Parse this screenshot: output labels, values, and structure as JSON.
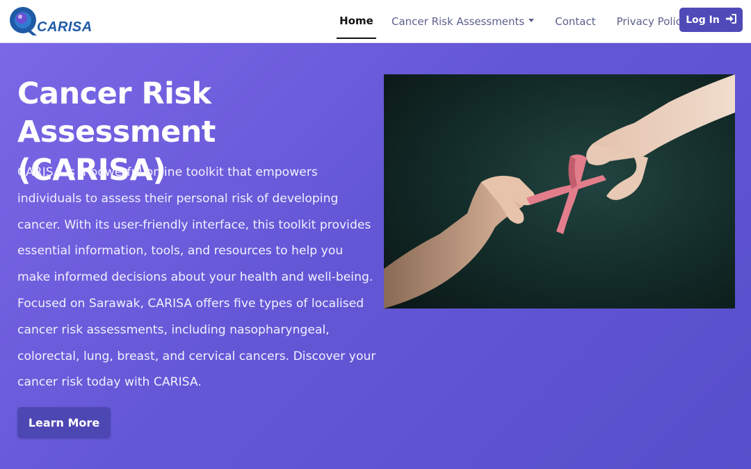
{
  "navbar": {
    "brand": {
      "name": "CARISA",
      "logo_icon": "q-logo-icon"
    },
    "links": [
      {
        "label": "Home",
        "active": true
      },
      {
        "label": "Cancer Risk Assessments",
        "dropdown": true
      },
      {
        "label": "Contact"
      },
      {
        "label": "Privacy Policy"
      }
    ],
    "login_label": "Log In",
    "login_icon": "sign-in-icon"
  },
  "hero": {
    "title": "Cancer Risk Assessment (CARISA)",
    "description": "CARISA is a powerful online toolkit that empowers individuals to assess their personal risk of developing cancer. With its user-friendly interface, this toolkit provides essential information, tools, and resources to help you make informed decisions about your health and well-being. Focused on Sarawak, CARISA offers five types of localised cancer risk assessments, including nasopharyngeal, colorectal, lung, breast, and cervical cancers. Discover your cancer risk today with CARISA.",
    "button_label": "Learn More",
    "image": "hands-holding-pink-ribbon-image"
  },
  "colors": {
    "accent": "#4f4ab8",
    "hero_bg": "#6a5cdc",
    "brand_blue": "#1f5aa6",
    "ribbon": "#e27d8c"
  }
}
